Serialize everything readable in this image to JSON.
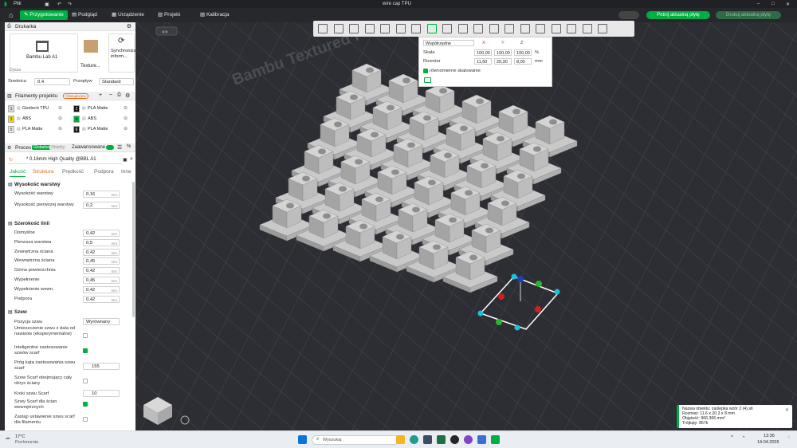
{
  "titlebar": {
    "menu_label": "Plik",
    "window_title": "wire cap TPU"
  },
  "navbar": {
    "home_label": "",
    "tabs": [
      "Przygotowanie",
      "Podgląd",
      "Urządzenie",
      "Projekt",
      "Kalibracja"
    ],
    "active_tab": "Przygotowanie",
    "slice_button": "Potnij aktualną płytę",
    "print_button": "Drukuj aktualną płytę"
  },
  "printer": {
    "section_title": "Drukarka",
    "printer_name": "Bambu Lab A1",
    "plate_name": "Texture...",
    "sync_label": "Synchronizacja inform...",
    "nozzle_header": "Dysza",
    "diameter_label": "Średnica",
    "diameter_value": "0.4",
    "flow_label": "Przepływ",
    "flow_value": "Standard"
  },
  "filaments": {
    "section_title": "Filamenty projektu",
    "badge": "Obsługiwane",
    "items": [
      {
        "num": "1",
        "name": "Geetech TPU",
        "color": "#d8d8d8"
      },
      {
        "num": "2",
        "name": "PLA Matte",
        "color": "#111111"
      },
      {
        "num": "3",
        "name": "ABS",
        "color": "#f5d800"
      },
      {
        "num": "4",
        "name": "ABS",
        "color": "#00ae42"
      },
      {
        "num": "5",
        "name": "PLA Matte",
        "color": "#e8e8e8"
      },
      {
        "num": "6",
        "name": "PLA Matte",
        "color": "#1a1a1a"
      }
    ]
  },
  "process": {
    "section_title": "Proces",
    "toggle_global": "Globalne",
    "toggle_object": "Obiekty",
    "advanced_label": "Zaawansowane",
    "preset": "* 0.16mm High Quality @BBL A1",
    "tabs": [
      "Jakość",
      "Struktura",
      "Prędkość",
      "Podpora",
      "Inne"
    ],
    "active_tab": "Jakość",
    "groups": {
      "layer_height": {
        "title": "Wysokość warstwy",
        "rows": [
          {
            "label": "Wysokość warstwy",
            "value": "0,16",
            "unit": "mm"
          },
          {
            "label": "Wysokość pierwszej warstwy",
            "value": "0,2",
            "unit": "mm"
          }
        ]
      },
      "line_width": {
        "title": "Szerokość linii",
        "rows": [
          {
            "label": "Domyślne",
            "value": "0,42",
            "unit": "mm"
          },
          {
            "label": "Pierwsza warstwa",
            "value": "0,5",
            "unit": "mm"
          },
          {
            "label": "Zewnętrzna ściana",
            "value": "0,42",
            "unit": "mm"
          },
          {
            "label": "Wewnętrzna ściana",
            "value": "0,45",
            "unit": "mm"
          },
          {
            "label": "Górna powierzchnia",
            "value": "0,42",
            "unit": "mm"
          },
          {
            "label": "Wypełnienie",
            "value": "0,45",
            "unit": "mm"
          },
          {
            "label": "Wypełnienie wewn.",
            "value": "0,42",
            "unit": "mm"
          },
          {
            "label": "Podpora",
            "value": "0,42",
            "unit": "mm"
          }
        ]
      },
      "seam": {
        "title": "Szew",
        "position_label": "Pozycja szwu",
        "position_value": "Wyrównany",
        "overhang_label": "Umieszczenie szwu z dala od nawisów (eksperymentalne)",
        "scarf_smart_label": "Inteligentne zastosowanie szwów scarf",
        "scarf_angle_label": "Próg kąta zastosowania szwu scarf",
        "scarf_angle_value": "155",
        "scarf_full_label": "Szew Scarf obejmujący cały obrys ściany",
        "scarf_steps_label": "Kroki szwu Scarf",
        "scarf_steps_value": "10",
        "scarf_inner_label": "Szwy Scarf dla ścian wewnętrznych",
        "replace_label": "Zastąp ustawienie szwu scarf dla filamentu"
      }
    }
  },
  "scale_dialog": {
    "coord_label": "Współrzędne",
    "axis_x": "X",
    "axis_y": "Y",
    "axis_z": "Z",
    "scale_label": "Skala",
    "scale_x": "100,00",
    "scale_y": "100,00",
    "scale_z": "100,00",
    "scale_unit": "%",
    "size_label": "Rozmiar",
    "size_x": "11,60",
    "size_y": "20,30",
    "size_z": "8,00",
    "size_unit": "mm",
    "uniform_label": "równomierne skalowanie"
  },
  "plate_text": "Bambu Textured PEI Plate",
  "info_popup": {
    "line1": "Nazwa obiektu: zaślepka wzór 2 (4).stl",
    "line2": "Rozmiar: 11.6 x 20.3 x 8 mm",
    "line3": "Objętość: 966.366 mm³",
    "line4": "Trójkąty: 857k"
  },
  "taskbar": {
    "weather_temp": "17°C",
    "weather_desc": "Pochmurnie",
    "search_placeholder": "Wyszukaj",
    "time": "13:36",
    "date": "14.04.2026"
  }
}
